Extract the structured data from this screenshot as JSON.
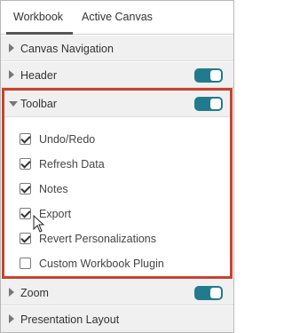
{
  "tabs": [
    {
      "label": "Workbook"
    },
    {
      "label": "Active Canvas"
    }
  ],
  "sections": {
    "canvas_navigation": {
      "label": "Canvas Navigation"
    },
    "header": {
      "label": "Header",
      "toggle_on": true
    },
    "toolbar": {
      "label": "Toolbar",
      "toggle_on": true
    },
    "zoom": {
      "label": "Zoom",
      "toggle_on": true
    },
    "presentation_layout": {
      "label": "Presentation Layout"
    }
  },
  "toolbar_options": [
    {
      "label": "Undo/Redo",
      "checked": true
    },
    {
      "label": "Refresh Data",
      "checked": true
    },
    {
      "label": "Notes",
      "checked": true
    },
    {
      "label": "Export",
      "checked": true
    },
    {
      "label": "Revert Personalizations",
      "checked": true
    },
    {
      "label": "Custom Workbook Plugin",
      "checked": false
    }
  ],
  "colors": {
    "toggle_on": "#227a8e",
    "highlight_border": "#c8432f",
    "section_bg": "#f0f0f0"
  },
  "icons": {
    "collapsed": "chevron-right-icon",
    "expanded": "chevron-down-icon",
    "cursor": "mouse-pointer-icon"
  }
}
